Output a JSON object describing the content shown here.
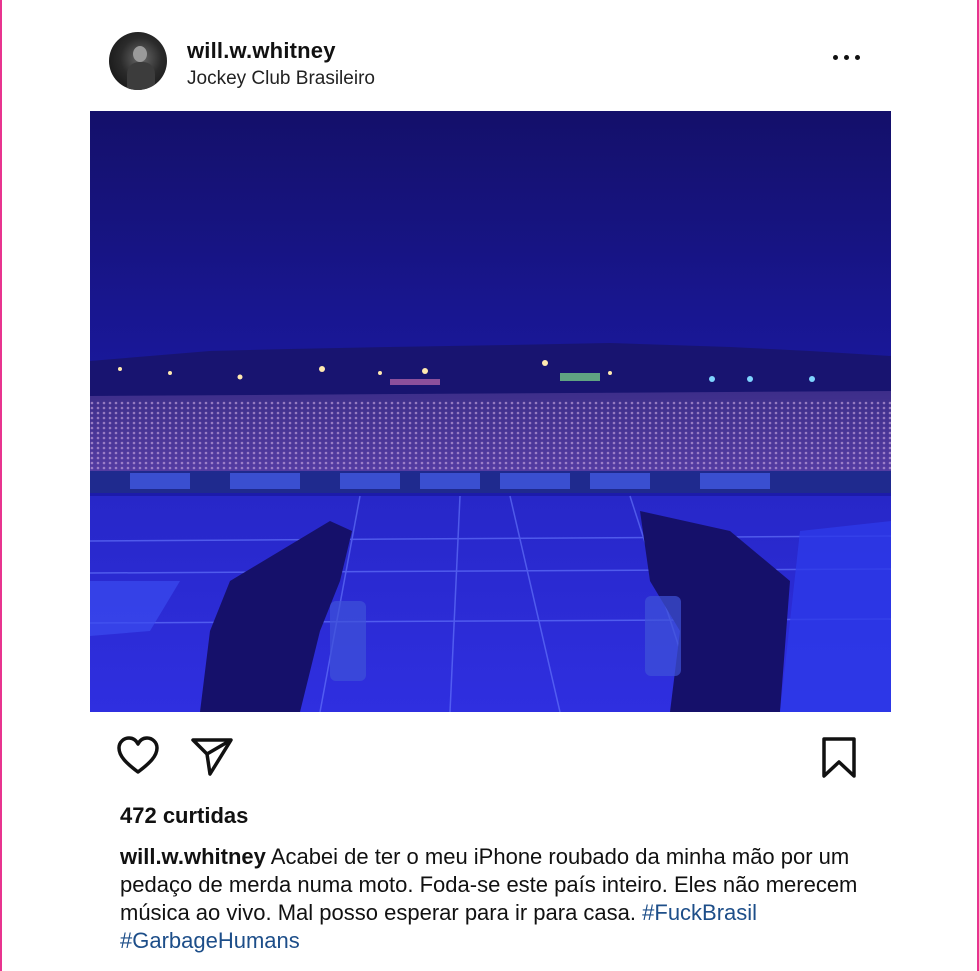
{
  "post": {
    "username": "will.w.whitney",
    "location": "Jockey Club Brasileiro",
    "more_icon": "ellipsis-icon",
    "likes": "472 curtidas",
    "caption_text": "Acabei de ter o meu iPhone roubado da minha mão por um pedaço de merda numa moto. Foda-se este país inteiro. Eles não merecem música ao vivo. Mal posso esperar para ir para casa.",
    "hashtags": [
      "#FuckBrasil",
      "#GarbageHumans"
    ],
    "photo_description": "concert-stage-view-blue"
  },
  "actions": {
    "like_icon": "heart-icon",
    "share_icon": "paper-plane-icon",
    "save_icon": "bookmark-icon"
  },
  "colors": {
    "accent_border": "#e8348f",
    "hashtag": "#1d4e89",
    "photo_blue": "#1c1c9a"
  }
}
